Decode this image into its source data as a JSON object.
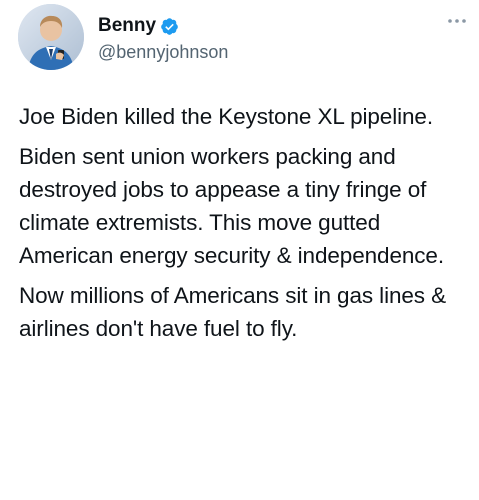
{
  "author": {
    "display_name": "Benny",
    "handle": "@bennyjohnson",
    "verified": true,
    "verified_color": "#1d9bf0",
    "avatar_icon": "profile-photo"
  },
  "more_icon": "more-options-icon",
  "tweet": {
    "paragraphs": [
      "Joe Biden killed the Keystone XL pipeline.",
      "Biden sent union workers packing and destroyed jobs to appease a tiny fringe of climate extremists. This move gutted American energy security & independence.",
      "Now millions of Americans sit in gas lines & airlines don't have fuel to fly."
    ]
  }
}
